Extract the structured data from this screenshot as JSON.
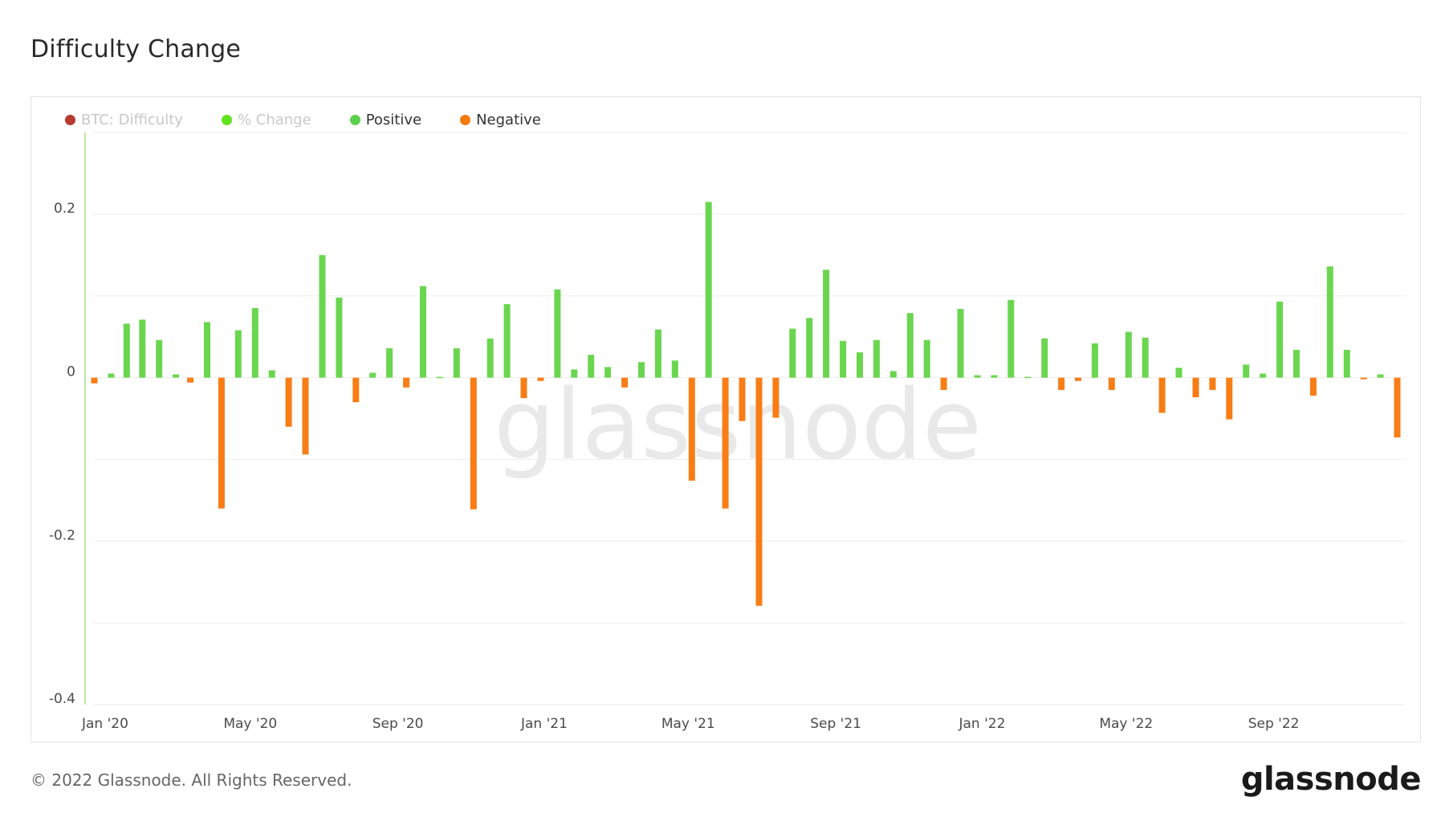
{
  "page": {
    "title": "Difficulty Change"
  },
  "footer": {
    "copyright": "© 2022 Glassnode. All Rights Reserved.",
    "logo_text": "glassnode"
  },
  "watermark": "glassnode",
  "legend": [
    {
      "label": "BTC: Difficulty",
      "color": "#b83a2e",
      "muted": true
    },
    {
      "label": "% Change",
      "color": "#63e21f",
      "muted": true
    },
    {
      "label": "Positive",
      "color": "#5ccf4c",
      "muted": false
    },
    {
      "label": "Negative",
      "color": "#f57a10",
      "muted": false
    }
  ],
  "colors": {
    "positive": "#6ad64f",
    "negative": "#f87d15",
    "grid": "#eeeeee",
    "axis_line": "#b9eaa9"
  },
  "chart_data": {
    "type": "bar",
    "title": "Difficulty Change",
    "xlabel": "",
    "ylabel": "",
    "ylim": [
      -0.4,
      0.3
    ],
    "y_ticks": [
      {
        "value": 0.2,
        "label": "0.2"
      },
      {
        "value": 0,
        "label": "0"
      },
      {
        "value": -0.2,
        "label": "-0.2"
      },
      {
        "value": -0.4,
        "label": "-0.4"
      }
    ],
    "y_gridlines": [
      0.3,
      0.2,
      0.1,
      0,
      -0.1,
      -0.2,
      -0.3,
      -0.4
    ],
    "xlim": [
      "2019-12-22",
      "2022-12-20"
    ],
    "x_ticks": [
      {
        "date": "2020-01-01",
        "label": "Jan '20"
      },
      {
        "date": "2020-05-01",
        "label": "May '20"
      },
      {
        "date": "2020-09-01",
        "label": "Sep '20"
      },
      {
        "date": "2021-01-01",
        "label": "Jan '21"
      },
      {
        "date": "2021-05-01",
        "label": "May '21"
      },
      {
        "date": "2021-09-01",
        "label": "Sep '21"
      },
      {
        "date": "2022-01-01",
        "label": "Jan '22"
      },
      {
        "date": "2022-05-01",
        "label": "May '22"
      },
      {
        "date": "2022-09-01",
        "label": "Sep '22"
      }
    ],
    "series": [
      {
        "name": "Positive",
        "x": [
          "2020-01-01",
          "2020-01-14",
          "2020-01-27",
          "2020-02-09",
          "2020-02-22",
          "2020-03-06",
          "2020-03-19",
          "2020-04-01",
          "2020-04-14",
          "2020-04-27",
          "2020-05-10",
          "2020-05-23",
          "2020-06-05",
          "2020-06-18",
          "2020-07-01",
          "2020-07-14",
          "2020-07-27",
          "2020-08-09",
          "2020-08-22",
          "2020-09-04",
          "2020-09-17",
          "2020-09-30",
          "2020-10-13",
          "2020-10-26",
          "2020-11-08",
          "2020-11-21",
          "2020-12-04",
          "2020-12-17",
          "2020-12-30",
          "2021-01-12",
          "2021-01-25",
          "2021-02-07",
          "2021-02-20",
          "2021-03-05",
          "2021-03-18",
          "2021-03-31",
          "2021-04-13",
          "2021-04-26",
          "2021-05-09",
          "2021-05-22",
          "2021-06-04",
          "2021-06-17",
          "2021-06-30",
          "2021-07-13",
          "2021-07-26",
          "2021-08-08",
          "2021-08-21",
          "2021-09-03",
          "2021-09-16",
          "2021-09-29",
          "2021-10-12",
          "2021-10-25",
          "2021-11-07",
          "2021-11-20",
          "2021-12-03",
          "2021-12-16",
          "2021-12-29",
          "2022-01-11",
          "2022-01-24",
          "2022-02-06",
          "2022-02-19",
          "2022-03-04",
          "2022-03-17",
          "2022-03-30",
          "2022-04-12",
          "2022-04-25",
          "2022-05-08",
          "2022-05-21",
          "2022-06-03",
          "2022-06-16",
          "2022-06-29",
          "2022-07-12",
          "2022-07-25",
          "2022-08-07",
          "2022-08-20",
          "2022-09-02",
          "2022-09-15",
          "2022-09-28",
          "2022-10-11",
          "2022-10-24",
          "2022-11-06",
          "2022-11-19",
          "2022-12-02",
          "2022-12-15"
        ],
        "values": [
          0.005,
          0.065,
          0.07,
          0.046,
          0.004,
          -0.006,
          0.068,
          -0.16,
          0.058,
          0.085,
          0.009,
          -0.06,
          -0.094,
          0.15,
          0.098,
          -0.03,
          0.006,
          0.036,
          -0.012,
          0.112,
          0.001,
          0.036,
          -0.161,
          0.048,
          0.09,
          -0.025,
          -0.004,
          0.108,
          0.01,
          0.028,
          0.013,
          -0.012,
          0.019,
          0.059,
          0.021,
          -0.126,
          -0.16,
          0.215,
          -0.053,
          -0.279,
          -0.049,
          0.06,
          0.073,
          0.132,
          0.045,
          0.031,
          0.046,
          0.008,
          0.079,
          0.046,
          -0.015,
          0.084,
          0.003,
          0.003,
          0.095,
          0.001,
          0.048,
          -0.015,
          -0.004,
          0.042,
          -0.015,
          0.056,
          0.049,
          -0.043,
          0.012,
          -0.024,
          -0.015,
          -0.051,
          0.016,
          0.005,
          0.093,
          0.034,
          -0.022,
          0.136,
          0.034,
          -0.002,
          0.004,
          -0.073,
          0,
          0,
          0,
          0,
          0,
          0
        ]
      },
      {
        "name": "Negative",
        "x": [
          "2020-01-01"
        ],
        "values": [
          0
        ]
      }
    ],
    "bars": [
      [
        "2019-12-23",
        -0.007
      ],
      [
        "2020-01-06",
        0.005
      ],
      [
        "2020-01-19",
        0.066
      ],
      [
        "2020-02-01",
        0.071
      ],
      [
        "2020-02-15",
        0.046
      ],
      [
        "2020-02-29",
        0.004
      ],
      [
        "2020-03-12",
        -0.006
      ],
      [
        "2020-03-26",
        0.068
      ],
      [
        "2020-04-07",
        -0.16
      ],
      [
        "2020-04-21",
        0.058
      ],
      [
        "2020-05-05",
        0.085
      ],
      [
        "2020-05-19",
        0.009
      ],
      [
        "2020-06-02",
        -0.06
      ],
      [
        "2020-06-16",
        -0.094
      ],
      [
        "2020-06-30",
        0.15
      ],
      [
        "2020-07-14",
        0.098
      ],
      [
        "2020-07-28",
        -0.03
      ],
      [
        "2020-08-11",
        0.006
      ],
      [
        "2020-08-25",
        0.036
      ],
      [
        "2020-09-08",
        -0.012
      ],
      [
        "2020-09-22",
        0.112
      ],
      [
        "2020-10-06",
        0.001
      ],
      [
        "2020-10-20",
        0.036
      ],
      [
        "2020-11-03",
        -0.161
      ],
      [
        "2020-11-17",
        0.048
      ],
      [
        "2020-12-01",
        0.09
      ],
      [
        "2020-12-15",
        -0.025
      ],
      [
        "2020-12-29",
        -0.004
      ],
      [
        "2021-01-12",
        0.108
      ],
      [
        "2021-01-26",
        0.01
      ],
      [
        "2021-02-09",
        0.028
      ],
      [
        "2021-02-23",
        0.013
      ],
      [
        "2021-03-09",
        -0.012
      ],
      [
        "2021-03-23",
        0.019
      ],
      [
        "2021-04-06",
        0.059
      ],
      [
        "2021-04-20",
        0.021
      ],
      [
        "2021-05-04",
        -0.126
      ],
      [
        "2021-05-18",
        0.215
      ],
      [
        "2021-06-01",
        -0.16
      ],
      [
        "2021-06-15",
        -0.053
      ],
      [
        "2021-06-29",
        -0.279
      ],
      [
        "2021-07-13",
        -0.049
      ],
      [
        "2021-07-27",
        0.06
      ],
      [
        "2021-08-10",
        0.073
      ],
      [
        "2021-08-24",
        0.132
      ],
      [
        "2021-09-07",
        0.045
      ],
      [
        "2021-09-21",
        0.031
      ],
      [
        "2021-10-05",
        0.046
      ],
      [
        "2021-10-19",
        0.008
      ],
      [
        "2021-11-02",
        0.079
      ],
      [
        "2021-11-16",
        0.046
      ],
      [
        "2021-11-30",
        -0.015
      ],
      [
        "2021-12-14",
        0.084
      ],
      [
        "2021-12-28",
        0.003
      ],
      [
        "2022-01-11",
        0.003
      ],
      [
        "2022-01-25",
        0.095
      ],
      [
        "2022-02-08",
        0.001
      ],
      [
        "2022-02-22",
        0.048
      ],
      [
        "2022-03-08",
        -0.015
      ],
      [
        "2022-03-22",
        -0.004
      ],
      [
        "2022-04-05",
        0.042
      ],
      [
        "2022-04-19",
        -0.015
      ],
      [
        "2022-05-03",
        0.056
      ],
      [
        "2022-05-17",
        0.049
      ],
      [
        "2022-05-31",
        -0.043
      ],
      [
        "2022-06-14",
        0.012
      ],
      [
        "2022-06-28",
        -0.024
      ],
      [
        "2022-07-12",
        -0.015
      ],
      [
        "2022-07-26",
        -0.051
      ],
      [
        "2022-08-09",
        0.016
      ],
      [
        "2022-08-23",
        0.005
      ],
      [
        "2022-09-06",
        0.093
      ],
      [
        "2022-09-20",
        0.034
      ],
      [
        "2022-10-04",
        -0.022
      ],
      [
        "2022-10-18",
        0.136
      ],
      [
        "2022-11-01",
        0.034
      ],
      [
        "2022-11-15",
        -0.002
      ],
      [
        "2022-11-29",
        0.004
      ],
      [
        "2022-12-13",
        -0.073
      ]
    ]
  }
}
